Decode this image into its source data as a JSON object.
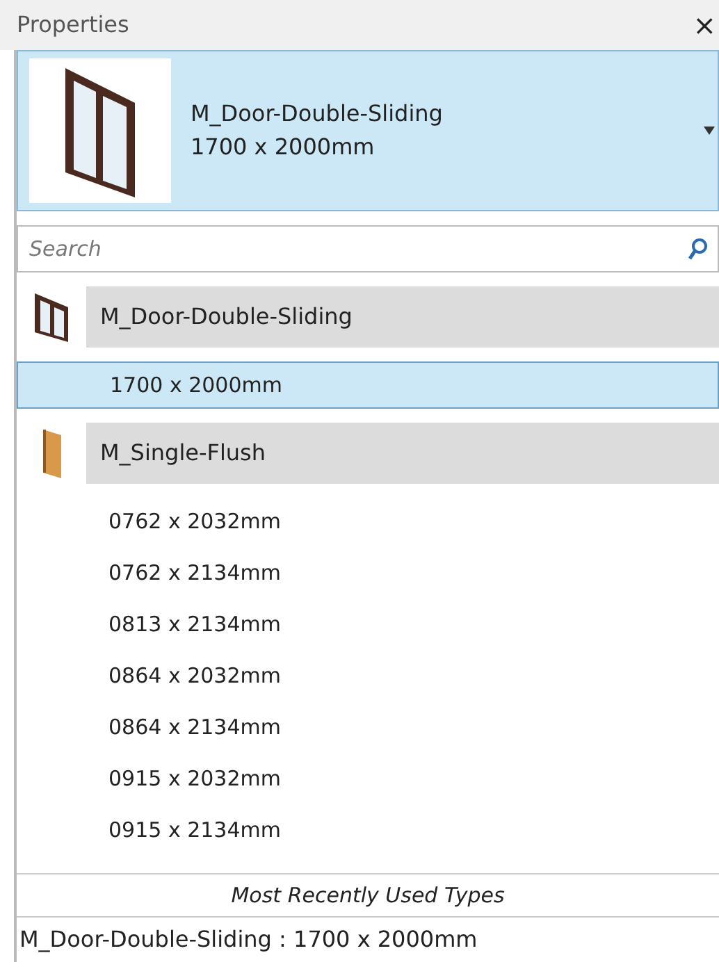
{
  "panel": {
    "title": "Properties",
    "close": "×"
  },
  "type_selector": {
    "family": "M_Door-Double-Sliding",
    "type": "1700 x 2000mm"
  },
  "search": {
    "placeholder": "Search"
  },
  "families": [
    {
      "name": "M_Door-Double-Sliding",
      "children": [
        {
          "name": "1700 x 2000mm",
          "selected": true
        }
      ]
    },
    {
      "name": "M_Single-Flush",
      "children": [
        {
          "name": "0762 x 2032mm",
          "selected": false
        },
        {
          "name": "0762 x 2134mm",
          "selected": false
        },
        {
          "name": "0813 x 2134mm",
          "selected": false
        },
        {
          "name": "0864 x 2032mm",
          "selected": false
        },
        {
          "name": "0864 x 2134mm",
          "selected": false
        },
        {
          "name": "0915 x 2032mm",
          "selected": false
        },
        {
          "name": "0915 x 2134mm",
          "selected": false
        }
      ]
    }
  ],
  "recent": {
    "heading": "Most Recently Used Types",
    "items": [
      "M_Door-Double-Sliding : 1700 x 2000mm"
    ]
  }
}
